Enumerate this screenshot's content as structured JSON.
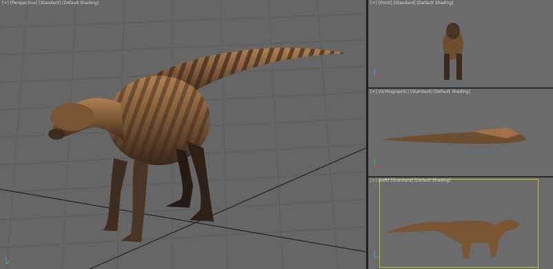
{
  "viewports": {
    "perspective": {
      "label": [
        "[+]",
        "[Perspective]",
        "[Standard]",
        "[Default Shading]"
      ]
    },
    "front": {
      "label": [
        "[+]",
        "[Front]",
        "[Standard]",
        "[Default Shading]"
      ]
    },
    "top": {
      "label": [
        "[+]",
        "[Orthographic]",
        "[Standard]",
        "[Default Shading]"
      ]
    },
    "left": {
      "label": [
        "[+]",
        "[Left]",
        "[Standard]",
        "[Default Shading]"
      ]
    }
  },
  "colors": {
    "viewport_bg": "#666666",
    "active_border": "#c9c232",
    "grid_line": "#5c5c5c",
    "model_base": "#8a6a44",
    "model_dark": "#3a2a1e",
    "model_light": "#c9a070"
  },
  "icons": {
    "axis": "xyz-axis-gizmo",
    "maximize": "viewport-label-menu"
  }
}
